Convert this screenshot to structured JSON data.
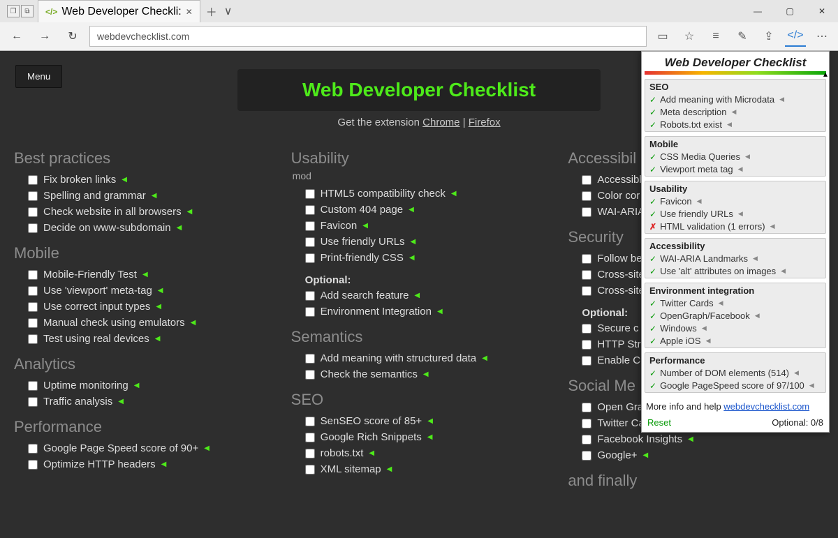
{
  "browser": {
    "tab_title": "Web Developer Checkli:",
    "url": "webdevchecklist.com"
  },
  "page": {
    "menu": "Menu",
    "title": "Web Developer Checklist",
    "get_text": "Get the extension ",
    "chrome": "Chrome",
    "sep": " | ",
    "firefox": "Firefox"
  },
  "col1": [
    {
      "title": "Best practices",
      "items": [
        "Fix broken links",
        "Spelling and grammar",
        "Check website in all browsers",
        "Decide on www-subdomain"
      ]
    },
    {
      "title": "Mobile",
      "items": [
        "Mobile-Friendly Test",
        "Use 'viewport' meta-tag",
        "Use correct input types",
        "Manual check using emulators",
        "Test using real devices"
      ]
    },
    {
      "title": "Analytics",
      "items": [
        "Uptime monitoring",
        "Traffic analysis"
      ]
    },
    {
      "title": "Performance",
      "items": [
        "Google Page Speed score of 90+",
        "Optimize HTTP headers"
      ]
    }
  ],
  "col2": [
    {
      "title": "Usability",
      "sub": "mod",
      "items": [
        "HTML5 compatibility check",
        "Custom 404 page",
        "Favicon",
        "Use friendly URLs",
        "Print-friendly CSS"
      ],
      "optional": [
        "Add search feature",
        "Environment Integration"
      ]
    },
    {
      "title": "Semantics",
      "items": [
        "Add meaning with structured data",
        "Check the semantics"
      ]
    },
    {
      "title": "SEO",
      "items": [
        "SenSEO score of 85+",
        "Google Rich Snippets",
        "robots.txt",
        "XML sitemap"
      ]
    }
  ],
  "col3": [
    {
      "title": "Accessibil",
      "items": [
        "Accessibl",
        "Color cor",
        "WAI-ARIA"
      ]
    },
    {
      "title": "Security",
      "items": [
        "Follow be",
        "Cross-site",
        "Cross-site"
      ],
      "optional": [
        "Secure c",
        "HTTP Str",
        "Enable C"
      ]
    },
    {
      "title": "Social Me",
      "items": [
        "Open Gra",
        "Twitter Cards",
        "Facebook Insights",
        "Google+"
      ]
    },
    {
      "title": "and finally",
      "items": []
    }
  ],
  "opt_label": "Optional:",
  "ext": {
    "title": "Web Developer Checklist",
    "sections": [
      {
        "name": "SEO",
        "items": [
          {
            "t": "Add meaning with Microdata",
            "ok": true
          },
          {
            "t": "Meta description",
            "ok": true
          },
          {
            "t": "Robots.txt exist",
            "ok": true
          }
        ]
      },
      {
        "name": "Mobile",
        "items": [
          {
            "t": "CSS Media Queries",
            "ok": true
          },
          {
            "t": "Viewport meta tag",
            "ok": true
          }
        ]
      },
      {
        "name": "Usability",
        "items": [
          {
            "t": "Favicon",
            "ok": true
          },
          {
            "t": "Use friendly URLs",
            "ok": true
          },
          {
            "t": "HTML validation (1 errors)",
            "ok": false
          }
        ]
      },
      {
        "name": "Accessibility",
        "items": [
          {
            "t": "WAI-ARIA Landmarks",
            "ok": true
          },
          {
            "t": "Use 'alt' attributes on images",
            "ok": true
          }
        ]
      },
      {
        "name": "Environment integration",
        "items": [
          {
            "t": "Twitter Cards",
            "ok": true
          },
          {
            "t": "OpenGraph/Facebook",
            "ok": true
          },
          {
            "t": "Windows",
            "ok": true
          },
          {
            "t": "Apple iOS",
            "ok": true
          }
        ]
      },
      {
        "name": "Performance",
        "items": [
          {
            "t": "Number of DOM elements (514)",
            "ok": true
          },
          {
            "t": "Google PageSpeed score of 97/100",
            "ok": true
          }
        ]
      }
    ],
    "footer_text": "More info and help ",
    "footer_link": "webdevchecklist.com",
    "reset": "Reset",
    "optional": "Optional: 0/8"
  }
}
